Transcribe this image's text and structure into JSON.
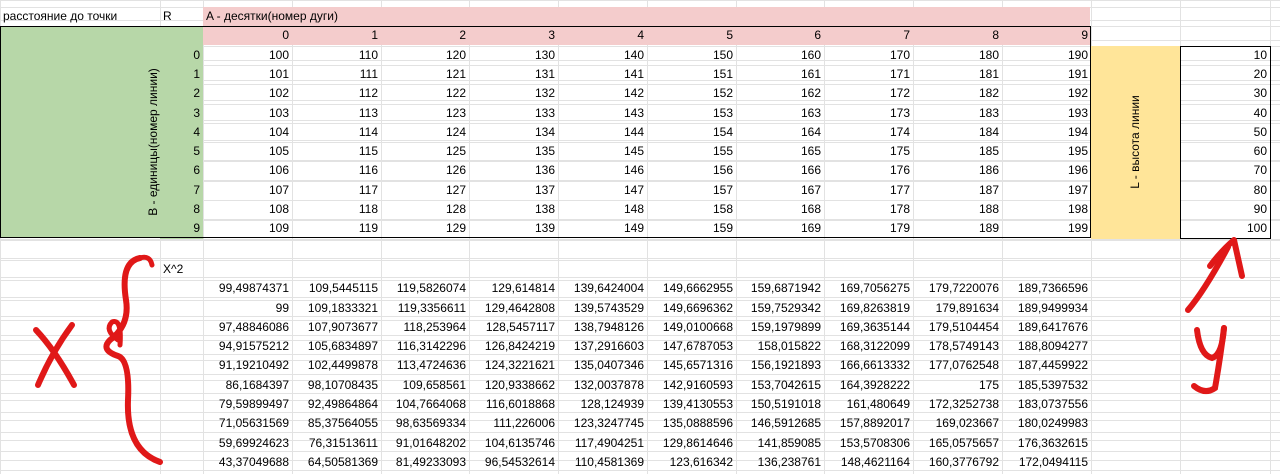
{
  "sheet": {
    "header_label": "расстояние до точки",
    "r_label": "R",
    "a_label": "A - десятки(номер дуги)",
    "b_label": "B - единицы(номер линии)",
    "l_label": "L - высота линии",
    "x2_label": "X^2",
    "a_values": [
      "0",
      "1",
      "2",
      "3",
      "4",
      "5",
      "6",
      "7",
      "8",
      "9"
    ],
    "b_values": [
      "0",
      "1",
      "2",
      "3",
      "4",
      "5",
      "6",
      "7",
      "8",
      "9"
    ],
    "l_values": [
      "10",
      "20",
      "30",
      "40",
      "50",
      "60",
      "70",
      "80",
      "90",
      "100"
    ],
    "r_table": [
      [
        "100",
        "110",
        "120",
        "130",
        "140",
        "150",
        "160",
        "170",
        "180",
        "190"
      ],
      [
        "101",
        "111",
        "121",
        "131",
        "141",
        "151",
        "161",
        "171",
        "181",
        "191"
      ],
      [
        "102",
        "112",
        "122",
        "132",
        "142",
        "152",
        "162",
        "172",
        "182",
        "192"
      ],
      [
        "103",
        "113",
        "123",
        "133",
        "143",
        "153",
        "163",
        "173",
        "183",
        "193"
      ],
      [
        "104",
        "114",
        "124",
        "134",
        "144",
        "154",
        "164",
        "174",
        "184",
        "194"
      ],
      [
        "105",
        "115",
        "125",
        "135",
        "145",
        "155",
        "165",
        "175",
        "185",
        "195"
      ],
      [
        "106",
        "116",
        "126",
        "136",
        "146",
        "156",
        "166",
        "176",
        "186",
        "196"
      ],
      [
        "107",
        "117",
        "127",
        "137",
        "147",
        "157",
        "167",
        "177",
        "187",
        "197"
      ],
      [
        "108",
        "118",
        "128",
        "138",
        "148",
        "158",
        "168",
        "178",
        "188",
        "198"
      ],
      [
        "109",
        "119",
        "129",
        "139",
        "149",
        "159",
        "169",
        "179",
        "189",
        "199"
      ]
    ],
    "x_table": [
      [
        "99,49874371",
        "109,5445115",
        "119,5826074",
        "129,614814",
        "139,6424004",
        "149,6662955",
        "159,6871942",
        "169,7056275",
        "179,7220076",
        "189,7366596"
      ],
      [
        "99",
        "109,1833321",
        "119,3356611",
        "129,4642808",
        "139,5743529",
        "149,6696362",
        "159,7529342",
        "169,8263819",
        "179,891634",
        "189,9499934"
      ],
      [
        "97,48846086",
        "107,9073677",
        "118,253964",
        "128,5457117",
        "138,7948126",
        "149,0100668",
        "159,1979899",
        "169,3635144",
        "179,5104454",
        "189,6417676"
      ],
      [
        "94,91575212",
        "105,6834897",
        "116,3142296",
        "126,8424219",
        "137,2916603",
        "147,6787053",
        "158,015822",
        "168,3122099",
        "178,5749143",
        "188,8094277"
      ],
      [
        "91,19210492",
        "102,4499878",
        "113,4724636",
        "124,3221621",
        "135,0407346",
        "145,6571316",
        "156,1921893",
        "166,6613332",
        "177,0762548",
        "187,4459922"
      ],
      [
        "86,1684397",
        "98,10708435",
        "109,658561",
        "120,9338662",
        "132,0037878",
        "142,9160593",
        "153,7042615",
        "164,3928222",
        "175",
        "185,5397532"
      ],
      [
        "79,59899497",
        "92,49864864",
        "104,7664068",
        "116,6018868",
        "128,124939",
        "139,4130553",
        "150,5191018",
        "161,480649",
        "172,3252738",
        "183,0737556"
      ],
      [
        "71,05631569",
        "85,37564055",
        "98,63569334",
        "111,226006",
        "123,3247745",
        "135,0888596",
        "146,5912685",
        "157,8892017",
        "169,023667",
        "180,0249983"
      ],
      [
        "59,69924623",
        "76,31513611",
        "91,01648202",
        "104,6135746",
        "117,4904251",
        "129,8614646",
        "141,859085",
        "153,5708306",
        "165,0575657",
        "176,3632615"
      ],
      [
        "43,37049688",
        "64,50581369",
        "81,49233093",
        "96,54532614",
        "110,4581369",
        "123,616342",
        "136,238761",
        "148,4621164",
        "160,3776792",
        "172,0494115"
      ]
    ]
  },
  "annotations": {
    "x_letter": "X",
    "y_letter": "Y"
  },
  "colors": {
    "pink": "#f4cccc",
    "green": "#b7d7a8",
    "yellow": "#ffe599",
    "ink_red": "#e01818",
    "grid": "#e2e2e2"
  }
}
